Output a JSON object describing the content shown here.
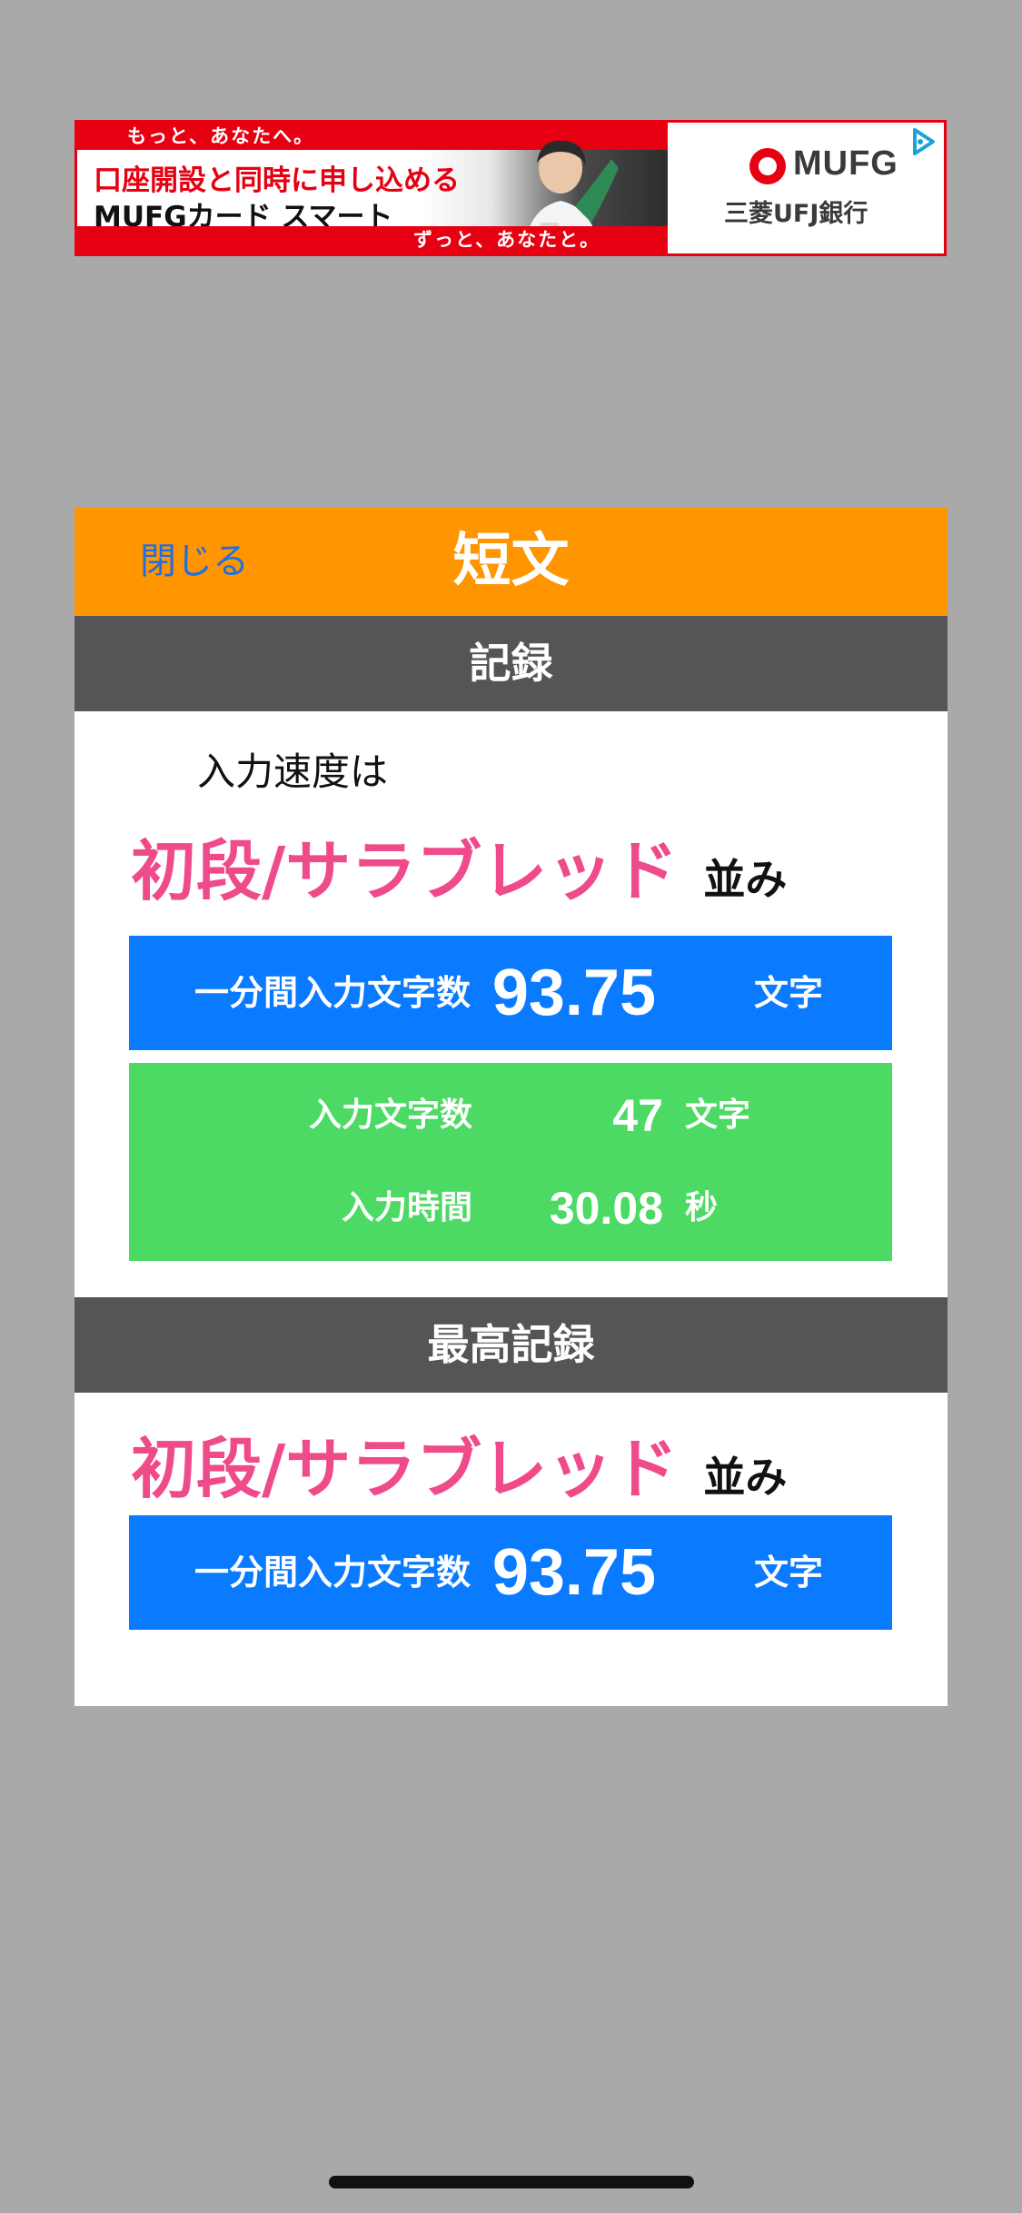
{
  "ad": {
    "top_strip_text": "もっと、あなたへ。",
    "headline": "口座開設と同時に申し込める",
    "product": "MUFGカード スマート",
    "bottom_strip_text": "ずっと、あなたと。",
    "brand": "MUFG",
    "bank_name": "三菱UFJ銀行",
    "icons": {
      "brand_mark": "mufg-logo-icon",
      "adchoices": "adchoices-icon"
    }
  },
  "modal": {
    "close_label": "閉じる",
    "title": "短文",
    "record_section": {
      "header": "記録",
      "intro": "入力速度は",
      "rank_name": "初段/サラブレッド",
      "rank_suffix": "並み",
      "per_minute": {
        "label": "一分間入力文字数",
        "value": "93.75",
        "unit": "文字"
      },
      "char_count": {
        "label": "入力文字数",
        "value": "47",
        "unit": "文字"
      },
      "input_time": {
        "label": "入力時間",
        "value": "30.08",
        "unit": "秒"
      }
    },
    "best_section": {
      "header": "最高記録",
      "rank_name": "初段/サラブレッド",
      "rank_suffix": "並み",
      "per_minute": {
        "label": "一分間入力文字数",
        "value": "93.75",
        "unit": "文字"
      }
    }
  },
  "colors": {
    "background": "#a9a9a9",
    "header_orange": "#ff9500",
    "section_gray": "#555555",
    "rank_pink": "#ef4b8b",
    "stat_blue": "#0a7aff",
    "stat_green": "#4cd964",
    "close_link_blue": "#1e6fe0",
    "ad_red": "#e60012"
  }
}
